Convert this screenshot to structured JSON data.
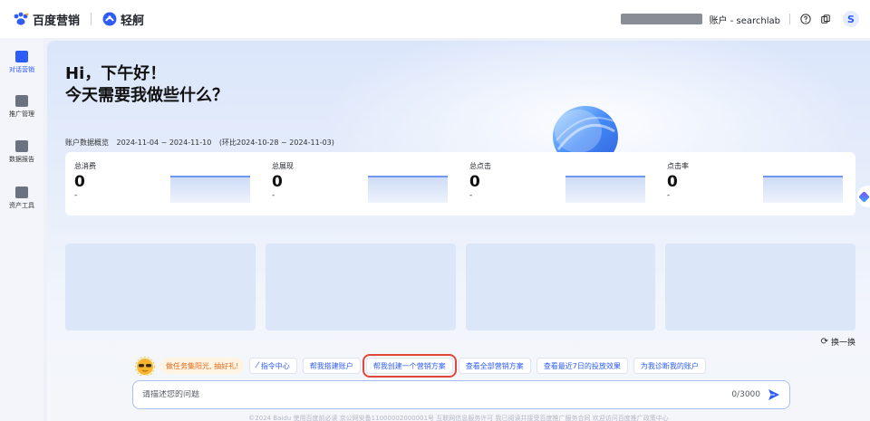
{
  "header": {
    "brand": "百度营销",
    "product": "轻舸",
    "account_text": "账户 - searchlab",
    "avatar_letter": "S",
    "icons": [
      "help-icon",
      "copy-icon"
    ]
  },
  "sidebar": {
    "items": [
      {
        "label": "对话营销",
        "icon": "chat-marketing-icon",
        "active": true
      },
      {
        "label": "推广管理",
        "icon": "promotion-icon",
        "active": false
      },
      {
        "label": "数据报告",
        "icon": "report-icon",
        "active": false
      },
      {
        "label": "资产工具",
        "icon": "toolbox-icon",
        "active": false
      }
    ]
  },
  "hero": {
    "greeting_line1": "Hi，下午好！",
    "greeting_line2": "今天需要我做些什么？"
  },
  "overview": {
    "label": "账户数据概览",
    "range": "2024-11-04 ~ 2024-11-10",
    "compare": "(环比2024-10-28 ~ 2024-11-03)"
  },
  "stats": [
    {
      "label": "总消费",
      "value": "0",
      "change": "-"
    },
    {
      "label": "总展现",
      "value": "0",
      "change": "-"
    },
    {
      "label": "总点击",
      "value": "0",
      "change": "-"
    },
    {
      "label": "点击率",
      "value": "0",
      "change": "-"
    }
  ],
  "refresh_label": "换一换",
  "task_chip": "做任务集阳光, 抽好礼!",
  "chips": [
    {
      "label": "指令中心",
      "icon": "command-icon"
    },
    {
      "label": "帮我搭建账户"
    },
    {
      "label": "帮我创建一个营销方案",
      "highlight": true
    },
    {
      "label": "查看全部营销方案"
    },
    {
      "label": "查看最近7日的投放效果"
    },
    {
      "label": "为我诊断我的账户"
    }
  ],
  "prompt": {
    "placeholder": "请描述您的问题",
    "count": "0/3000"
  },
  "footer": "©2024 Baidu 使用百度前必读 京公网安备11000002000001号 互联网信息服务许可 我已阅读并接受百度推广服务合同 欢迎访问百度推广政策中心",
  "colors": {
    "accent": "#2d5cf6",
    "highlight_box": "#e0463a",
    "task_text": "#e06c1c"
  }
}
